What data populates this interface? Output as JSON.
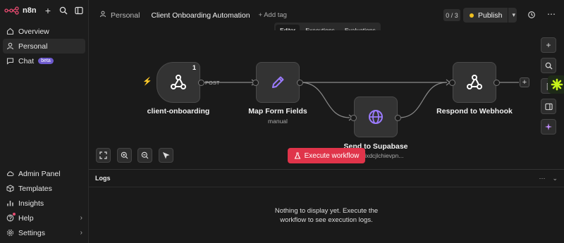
{
  "app": {
    "name": "n8n"
  },
  "sidebar": {
    "top_items": [
      {
        "label": "Overview",
        "icon": "home-icon"
      },
      {
        "label": "Personal",
        "icon": "user-icon"
      },
      {
        "label": "Chat",
        "icon": "chat-icon",
        "badge": "beta"
      }
    ],
    "bottom_items": [
      {
        "label": "Admin Panel",
        "icon": "cloud-icon"
      },
      {
        "label": "Templates",
        "icon": "box-icon"
      },
      {
        "label": "Insights",
        "icon": "chart-icon"
      },
      {
        "label": "Help",
        "icon": "help-icon"
      },
      {
        "label": "Settings",
        "icon": "gear-icon"
      }
    ]
  },
  "header": {
    "project": "Personal",
    "workflow_title": "Client Onboarding Automation",
    "add_tag": "+ Add tag",
    "counter": "0 / 3",
    "publish_label": "Publish",
    "tabs": [
      {
        "label": "Editor",
        "active": true
      },
      {
        "label": "Executions",
        "active": false
      },
      {
        "label": "Evaluations",
        "active": false
      }
    ]
  },
  "canvas": {
    "nodes": [
      {
        "name": "client-onboarding",
        "subtitle": "",
        "badge": "1",
        "icon": "webhook-icon"
      },
      {
        "name": "Map Form Fields",
        "subtitle": "manual",
        "icon": "pencil-icon"
      },
      {
        "name": "Send to Supabase",
        "subtitle": "://fvixdcjlchievpn...",
        "icon": "globe-icon"
      },
      {
        "name": "Respond to Webhook",
        "subtitle": "",
        "icon": "webhook-icon"
      }
    ],
    "edge_label": "POST",
    "execute_label": "Execute workflow"
  },
  "logs": {
    "title": "Logs",
    "empty_line1": "Nothing to display yet. Execute the",
    "empty_line2": "workflow to see execution logs."
  },
  "colors": {
    "accent_red": "#e0344a",
    "publish_dot": "#f0c020",
    "beta_badge": "#6d5acd",
    "node_icon_purple": "#9b7bff"
  }
}
